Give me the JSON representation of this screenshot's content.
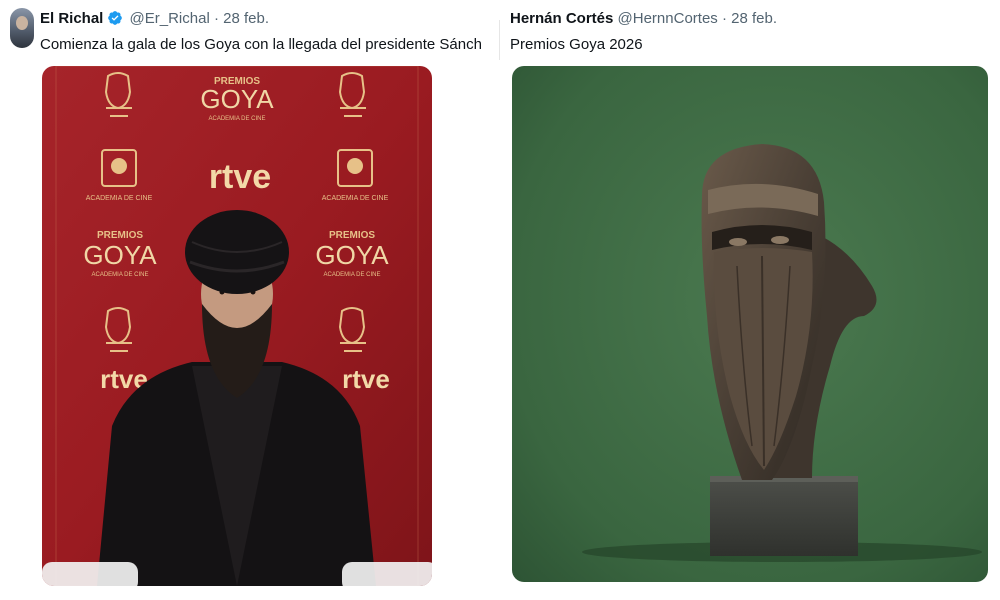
{
  "tweets": [
    {
      "author_name": "El Richal",
      "handle": "@Er_Richal",
      "separator": "·",
      "date": "28 feb.",
      "verified": true,
      "text": "Comienza la gala de los Goya con la llegada del presidente Sánch",
      "media": {
        "backdrop_logos": {
          "premios": "PREMIOS",
          "goya": "GOYA",
          "academia": "ACADEMIA DE CINE",
          "rtve": "rtve",
          "academia_caps": "ACADEMIA DE CINE"
        },
        "backdrop_color": "#9e1c22"
      }
    },
    {
      "author_name": "Hernán Cortés",
      "handle": "@HernnCortes",
      "separator": "·",
      "date": "28 feb.",
      "verified": false,
      "text": "Premios Goya 2026",
      "media": {
        "background_color": "#3e6a43"
      }
    }
  ],
  "colors": {
    "text": "#0f1419",
    "muted": "#536471",
    "verified": "#1d9bf0"
  }
}
